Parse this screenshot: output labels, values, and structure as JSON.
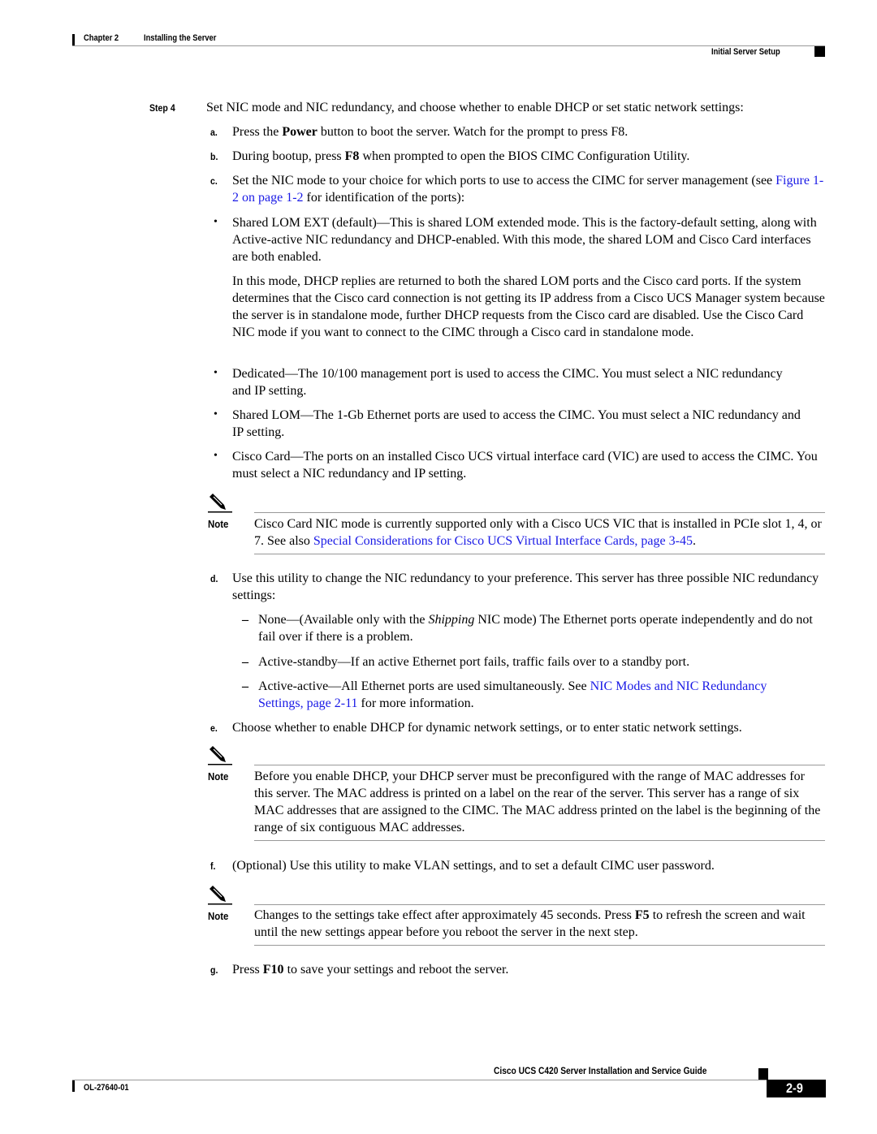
{
  "header": {
    "chapter": "Chapter 2",
    "chapter_title": "Installing the Server",
    "section": "Initial Server Setup"
  },
  "step": {
    "label": "Step 4",
    "text": "Set NIC mode and NIC redundancy, and choose whether to enable DHCP or set static network settings:"
  },
  "substeps": {
    "a": {
      "label": "a.",
      "pre": "Press the ",
      "bold": "Power",
      "post": " button to boot the server. Watch for the prompt to press F8."
    },
    "b": {
      "label": "b.",
      "pre": "During bootup, press ",
      "bold": "F8",
      "post": " when prompted to open the BIOS CIMC Configuration Utility."
    },
    "c": {
      "label": "c.",
      "pre": "Set the NIC mode to your choice for which ports to use to access the CIMC for server management (see ",
      "link": "Figure 1-2 on page 1-2",
      "post": " for identification of the ports):"
    },
    "d": {
      "label": "d.",
      "text": "Use this utility to change the NIC redundancy to your preference. This server has three possible NIC redundancy settings:"
    },
    "e": {
      "label": "e.",
      "text": "Choose whether to enable DHCP for dynamic network settings, or to enter static network settings."
    },
    "f": {
      "label": "f.",
      "text": "(Optional) Use this utility to make VLAN settings, and to set a default CIMC user password."
    },
    "g": {
      "label": "g.",
      "pre": "Press ",
      "bold": "F10",
      "post": " to save your settings and reboot the server."
    }
  },
  "nic_modes": [
    {
      "text": "Shared LOM EXT (default)—This is shared LOM extended mode. This is the factory-default setting, along with Active-active NIC redundancy and DHCP-enabled. With this mode, the shared LOM and Cisco Card interfaces are both enabled.",
      "extra": "In this mode, DHCP replies are returned to both the shared LOM ports and the Cisco card ports. If the system determines that the Cisco card connection is not getting its IP address from a Cisco UCS Manager system because the server is in standalone mode, further DHCP requests from the Cisco card are disabled. Use the Cisco Card NIC mode if you want to connect to the CIMC through a Cisco card in standalone mode."
    },
    {
      "text": "Dedicated—The 10/100 management port is used to access the CIMC. You must select a NIC redundancy and IP setting."
    },
    {
      "text": "Shared LOM—The 1-Gb Ethernet ports are used to access the CIMC. You must select a NIC redundancy and IP setting."
    },
    {
      "text": "Cisco Card—The ports on an installed Cisco UCS virtual interface card (VIC) are used to access the CIMC. You must select a NIC redundancy and IP setting."
    }
  ],
  "redundancy": [
    {
      "pre": "None—(Available only with the ",
      "italic": "Shipping",
      "post": " NIC mode) The Ethernet ports operate independently and do not fail over if there is a problem."
    },
    {
      "pre": "Active-standby—If an active Ethernet port fails, traffic fails over to a standby port."
    },
    {
      "pre": "Active-active—All Ethernet ports are used simultaneously. See ",
      "link": "NIC Modes and NIC Redundancy Settings, page 2-11",
      "post": " for more information."
    }
  ],
  "notes": [
    {
      "label": "Note",
      "pre": "Cisco Card NIC mode is currently supported only with a Cisco UCS VIC that is installed in PCIe slot 1, 4, or 7. See also ",
      "link": "Special Considerations for Cisco UCS Virtual Interface Cards, page 3-45",
      "post": "."
    },
    {
      "label": "Note",
      "pre": "Before you enable DHCP, your DHCP server must be preconfigured with the range of MAC addresses for this server. The MAC address is printed on a label on the rear of the server. This server has a range of six MAC addresses that are assigned to the CIMC. The MAC address printed on the label is the beginning of the range of six contiguous MAC addresses."
    },
    {
      "label": "Note",
      "pre": "Changes to the settings take effect after approximately 45 seconds. Press ",
      "bold": "F5",
      "post": " to refresh the screen and wait until the new settings appear before you reboot the server in the next step."
    }
  ],
  "footer": {
    "guide_title": "Cisco UCS C420 Server Installation and Service Guide",
    "doc_number": "OL-27640-01",
    "page_number": "2-9"
  }
}
